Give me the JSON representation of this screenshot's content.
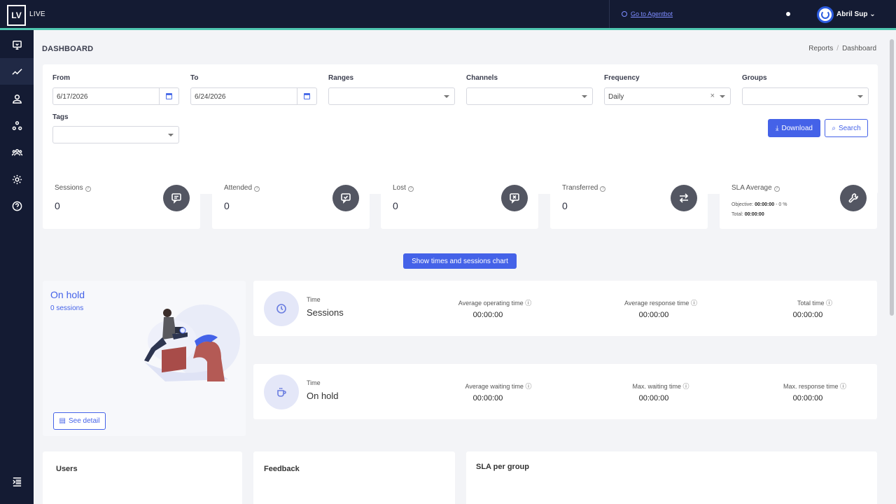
{
  "topbar": {
    "logo": "LV",
    "app_name": "LIVE",
    "agentbot_link": "Go to Agentbot",
    "user_name": "Abril Sup"
  },
  "page": {
    "title": "DASHBOARD",
    "breadcrumb": [
      "Reports",
      "Dashboard"
    ]
  },
  "filters": {
    "from_label": "From",
    "from_value": "6/17/2026",
    "to_label": "To",
    "to_value": "6/24/2026",
    "ranges_label": "Ranges",
    "ranges_value": "",
    "channels_label": "Channels",
    "channels_value": "",
    "frequency_label": "Frequency",
    "frequency_value": "Daily",
    "groups_label": "Groups",
    "groups_value": "",
    "tags_label": "Tags",
    "tags_value": "",
    "download_label": "Download",
    "search_label": "Search"
  },
  "stats": [
    {
      "label": "Sessions",
      "value": "0",
      "icon": "chat-icon"
    },
    {
      "label": "Attended",
      "value": "0",
      "icon": "chat-check-icon"
    },
    {
      "label": "Lost",
      "value": "0",
      "icon": "chat-x-icon"
    },
    {
      "label": "Transferred",
      "value": "0",
      "icon": "transfer-icon"
    }
  ],
  "sla": {
    "label": "SLA Average",
    "objective_label": "Objective:",
    "objective_value": "00:00:00",
    "objective_sep": "-",
    "objective_pct": "0 %",
    "total_label": "Total:",
    "total_value": "00:00:00"
  },
  "chart_button": "Show times and sessions chart",
  "onhold": {
    "title": "On hold",
    "sessions": "0 sessions",
    "see_detail": "See detail"
  },
  "time_sessions": {
    "small": "Time",
    "big": "Sessions",
    "cols": [
      {
        "label": "Average operating time",
        "value": "00:00:00"
      },
      {
        "label": "Average response time",
        "value": "00:00:00"
      },
      {
        "label": "Total time",
        "value": "00:00:00"
      }
    ]
  },
  "time_onhold": {
    "small": "Time",
    "big": "On hold",
    "cols": [
      {
        "label": "Average waiting time",
        "value": "00:00:00"
      },
      {
        "label": "Max. waiting time",
        "value": "00:00:00"
      },
      {
        "label": "Max. response time",
        "value": "00:00:00"
      }
    ]
  },
  "bottom": {
    "users": "Users",
    "feedback": "Feedback",
    "sla_per_group": "SLA per group"
  },
  "colors": {
    "sidebar": "#141b33",
    "accent": "#4462e8",
    "topbar_border": "#4fc6b0"
  }
}
